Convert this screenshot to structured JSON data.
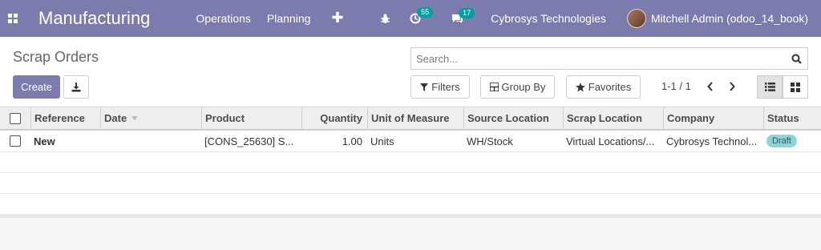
{
  "navbar": {
    "app_title": "Manufacturing",
    "menu": [
      "Operations",
      "Planning"
    ],
    "plus": "✚",
    "activity_count": "55",
    "message_count": "17",
    "company": "Cybrosys Technologies",
    "user": "Mitchell Admin (odoo_14_book)"
  },
  "control": {
    "breadcrumb": "Scrap Orders",
    "search_placeholder": "Search...",
    "create_label": "Create",
    "filters_label": "Filters",
    "groupby_label": "Group By",
    "favorites_label": "Favorites",
    "pager": "1-1 / 1"
  },
  "table": {
    "columns": [
      "Reference",
      "Date",
      "Product",
      "Quantity",
      "Unit of Measure",
      "Source Location",
      "Scrap Location",
      "Company",
      "Status"
    ],
    "rows": [
      {
        "reference": "New",
        "date": "",
        "product": "[CONS_25630] S...",
        "quantity": "1.00",
        "uom": "Units",
        "source": "WH/Stock",
        "scrap": "Virtual Locations/...",
        "company": "Cybrosys Technol...",
        "status": "Draft"
      }
    ]
  },
  "colors": {
    "brand": "#7c7bad",
    "badge": "#00a09d",
    "status_draft": "#8ed3d6"
  }
}
